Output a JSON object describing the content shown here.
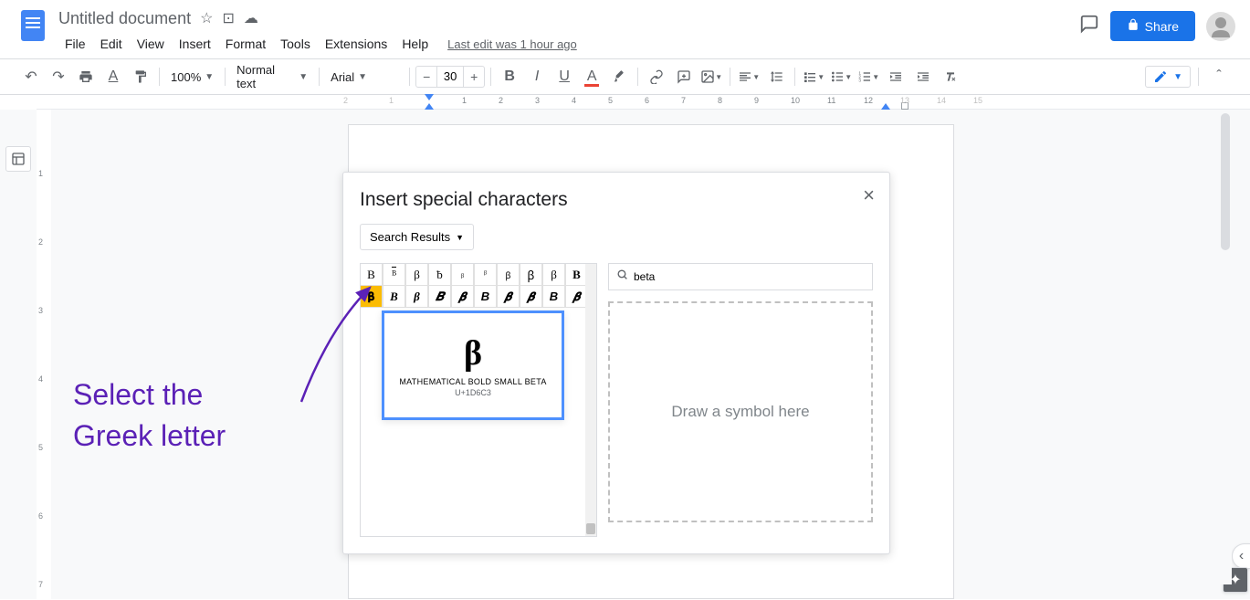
{
  "header": {
    "doc_title": "Untitled document",
    "last_edit": "Last edit was 1 hour ago",
    "share_label": "Share"
  },
  "menubar": [
    "File",
    "Edit",
    "View",
    "Insert",
    "Format",
    "Tools",
    "Extensions",
    "Help"
  ],
  "toolbar": {
    "zoom": "100%",
    "style": "Normal text",
    "font": "Arial",
    "font_size": "30"
  },
  "modal": {
    "title": "Insert special characters",
    "filter_label": "Search Results",
    "search_value": "beta",
    "draw_hint": "Draw a symbol here",
    "chars_row1": [
      "B",
      "ᴮ",
      "β",
      "ƀ",
      "ᵦ",
      "ᵝ",
      "ꞵ",
      "ꞵ",
      "β",
      "B"
    ],
    "chars_row2": [
      "𝛃",
      "B",
      "β",
      "𝑩",
      "𝜷",
      "B",
      "𝜷",
      "𝜷",
      "B",
      "𝜷"
    ],
    "preview": {
      "glyph": "β",
      "name": "MATHEMATICAL BOLD SMALL BETA",
      "code": "U+1D6C3"
    }
  },
  "ruler_numbers": [
    "2",
    "1",
    "1",
    "2",
    "3",
    "4",
    "5",
    "6",
    "7",
    "8",
    "9",
    "10",
    "11",
    "12",
    "13",
    "14",
    "15"
  ],
  "vruler_numbers": [
    "1",
    "2",
    "3",
    "4",
    "5",
    "6",
    "7"
  ],
  "annotation": {
    "line1": "Select the",
    "line2": "Greek letter"
  }
}
